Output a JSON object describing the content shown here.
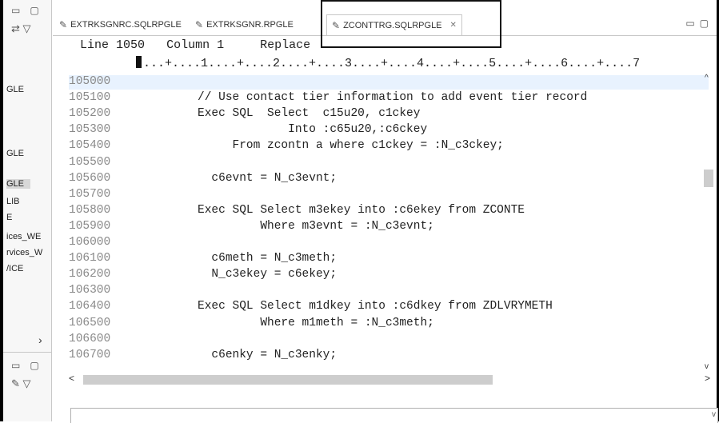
{
  "left_panel": {
    "items": [
      {
        "label": "GLE",
        "selected": false
      },
      {
        "label": "GLE",
        "selected": false
      },
      {
        "label": "GLE",
        "selected": true
      },
      {
        "label": "LIB",
        "selected": false
      },
      {
        "label": "E",
        "selected": false
      },
      {
        "label": "ices_WE",
        "selected": false
      },
      {
        "label": "rvices_W",
        "selected": false
      },
      {
        "label": "/ICE",
        "selected": false
      }
    ]
  },
  "tabs": [
    {
      "label": "EXTRKSGNRC.SQLRPGLE",
      "active": false
    },
    {
      "label": "EXTRKSGNR.RPGLE",
      "active": false
    },
    {
      "label": "ZCONTTRG.SQLRPGLE",
      "active": true
    }
  ],
  "status": {
    "line_label": "Line",
    "line_value": "1050",
    "column_label": "Column",
    "column_value": "1",
    "mode": "Replace"
  },
  "ruler_text": "...+....1....+....2....+....3....+....4....+....5....+....6....+....7",
  "code_lines": [
    {
      "num": "105000",
      "text": "",
      "current": true
    },
    {
      "num": "105100",
      "text": "          // Use contact tier information to add event tier record",
      "current": false
    },
    {
      "num": "105200",
      "text": "          Exec SQL  Select  c15u20, c1ckey",
      "current": false
    },
    {
      "num": "105300",
      "text": "                       Into :c65u20,:c6ckey",
      "current": false
    },
    {
      "num": "105400",
      "text": "               From zcontn a where c1ckey = :N_c3ckey;",
      "current": false
    },
    {
      "num": "105500",
      "text": "",
      "current": false
    },
    {
      "num": "105600",
      "text": "            c6evnt = N_c3evnt;",
      "current": false
    },
    {
      "num": "105700",
      "text": "",
      "current": false
    },
    {
      "num": "105800",
      "text": "          Exec SQL Select m3ekey into :c6ekey from ZCONTE",
      "current": false
    },
    {
      "num": "105900",
      "text": "                   Where m3evnt = :N_c3evnt;",
      "current": false
    },
    {
      "num": "106000",
      "text": "",
      "current": false
    },
    {
      "num": "106100",
      "text": "            c6meth = N_c3meth;",
      "current": false
    },
    {
      "num": "106200",
      "text": "            N_c3ekey = c6ekey;",
      "current": false
    },
    {
      "num": "106300",
      "text": "",
      "current": false
    },
    {
      "num": "106400",
      "text": "          Exec SQL Select m1dkey into :c6dkey from ZDLVRYMETH",
      "current": false
    },
    {
      "num": "106500",
      "text": "                   Where m1meth = :N_c3meth;",
      "current": false
    },
    {
      "num": "106600",
      "text": "",
      "current": false
    },
    {
      "num": "106700",
      "text": "            c6enky = N_c3enky;",
      "current": false
    }
  ],
  "colors": {
    "current_line": "#e8f2fe",
    "line_numbers": "#8a8a8a",
    "text": "#222222"
  }
}
